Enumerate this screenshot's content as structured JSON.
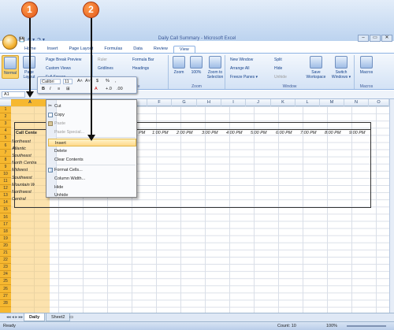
{
  "window": {
    "title": "Daily Call Summary - Microsoft Excel",
    "controls": [
      "–",
      "▭",
      "✕"
    ]
  },
  "qat": [
    "💾",
    "↶ ▾",
    "↷ ▾"
  ],
  "tabs": [
    "Home",
    "Insert",
    "Page Layout",
    "Formulas",
    "Data",
    "Review",
    "View"
  ],
  "active_tab": "View",
  "ribbon": {
    "normal": "Normal",
    "page_layout": "Page Layout",
    "page_break_preview": "Page Break Preview",
    "custom_views": "Custom Views",
    "full_screen": "Full Screen",
    "ruler": "Ruler",
    "gridlines": "Gridlines",
    "formula_bar": "Formula Bar",
    "headings": "Headings",
    "show_hide_label": "Show/Hide",
    "zoom": "Zoom",
    "zoom100": "100%",
    "zoom_selection": "Zoom to Selection",
    "zoom_group": "Zoom",
    "new_window": "New Window",
    "arrange_all": "Arrange All",
    "freeze_panes": "Freeze Panes ▾",
    "split": "Split",
    "hide": "Hide",
    "unhide": "Unhide",
    "save_workspace": "Save Workspace",
    "switch_windows": "Switch Windows ▾",
    "window_group": "Window",
    "macros": "Macros",
    "macros_group": "Macros"
  },
  "namebox": "A1",
  "columns": [
    "A",
    "B",
    "C",
    "D",
    "E",
    "F",
    "G",
    "H",
    "I",
    "J",
    "K",
    "L",
    "M",
    "N",
    "O"
  ],
  "rows": [
    "1",
    "2",
    "3",
    "4",
    "5",
    "6",
    "7",
    "8",
    "9",
    "10",
    "11",
    "12",
    "13",
    "14",
    "15",
    "16",
    "17",
    "18",
    "19",
    "20",
    "21",
    "22",
    "23",
    "24",
    "25",
    "26",
    "27",
    "28"
  ],
  "cells": {
    "title": "Call Cente",
    "regions": [
      "Northeast",
      "Atlantic",
      "Southeast",
      "North Centra",
      "Midwest",
      "Southwest",
      "Mountain W",
      "Northwest",
      "Central"
    ],
    "hours": [
      "1:00 PM",
      "2:00 PM",
      "3:00 PM",
      "4:00 PM",
      "5:00 PM",
      "6:00 PM",
      "7:00 PM",
      "8:00 PM",
      "9:00 PM"
    ],
    "partial_hour": "PM"
  },
  "mini_toolbar": {
    "font": "Calibri",
    "size": "11",
    "row1": [
      "A˄",
      "A˅",
      "$",
      "%",
      ","
    ],
    "row2": [
      "B",
      "I",
      "≡",
      "⊞",
      "A",
      "+.0",
      ".00"
    ]
  },
  "context_menu": [
    "Cut",
    "Copy",
    "Paste",
    "Paste Special...",
    "Insert",
    "Delete",
    "Clear Contents",
    "Format Cells...",
    "Column Width...",
    "Hide",
    "Unhide"
  ],
  "callouts": [
    "1",
    "2"
  ],
  "sheet_tabs": [
    "Daily",
    "Sheet2"
  ],
  "status": {
    "ready": "Ready",
    "count": "Count: 10",
    "zoom": "100%"
  },
  "colors": {
    "selection": "#f6b830",
    "ribbon": "#d3e2f5",
    "callout": "#e2581a",
    "menu_highlight": "#ffd98a"
  }
}
